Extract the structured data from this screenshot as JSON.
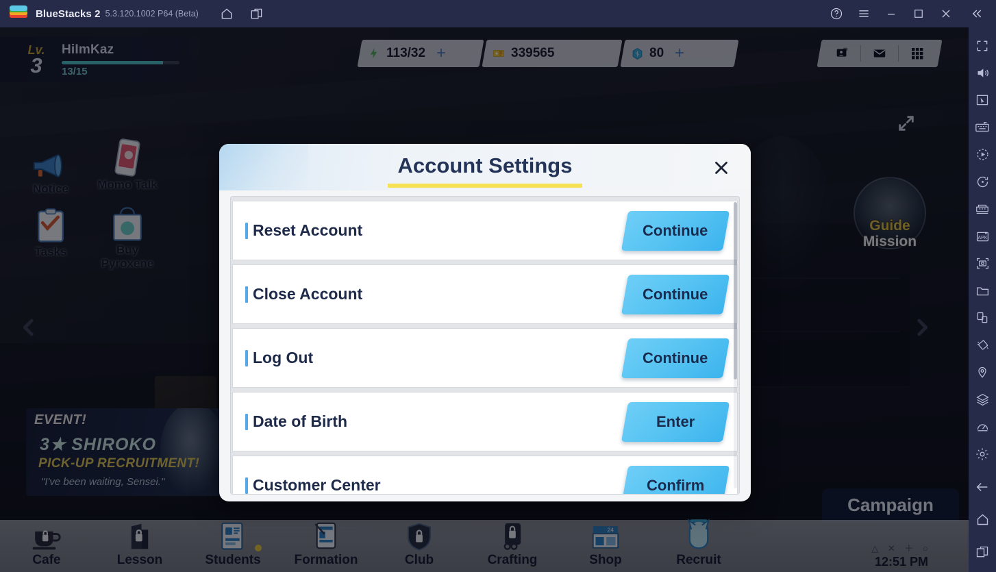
{
  "titlebar": {
    "app_name": "BlueStacks 2",
    "version": "5.3.120.1002 P64 (Beta)",
    "icons": {
      "logo": "bluestacks-logo",
      "home": "home-icon",
      "multi_instance": "multi-instance-icon",
      "help": "help-icon",
      "menu": "hamburger-menu-icon",
      "minimize": "minimize-icon",
      "maximize": "maximize-icon",
      "close": "close-icon",
      "collapse": "double-chevron-left-icon"
    }
  },
  "sidebar": {
    "items": [
      {
        "name": "fullscreen-icon"
      },
      {
        "name": "volume-icon"
      },
      {
        "name": "cursor-pointer-icon"
      },
      {
        "name": "keyboard-controls-icon"
      },
      {
        "name": "macro-record-icon"
      },
      {
        "name": "rotate-icon"
      },
      {
        "name": "multi-instance-manager-icon"
      },
      {
        "name": "install-apk-icon"
      },
      {
        "name": "screenshot-icon"
      },
      {
        "name": "media-folder-icon"
      },
      {
        "name": "copy-paste-icon"
      },
      {
        "name": "shake-icon"
      },
      {
        "name": "location-icon"
      },
      {
        "name": "layers-icon"
      },
      {
        "name": "performance-icon"
      },
      {
        "name": "settings-gear-icon"
      },
      {
        "name": "back-icon"
      },
      {
        "name": "home-icon"
      },
      {
        "name": "recents-icon"
      }
    ]
  },
  "game": {
    "player": {
      "lv_label": "Lv.",
      "level": "3",
      "name": "HiImKaz",
      "xp": "13/15"
    },
    "currencies": [
      {
        "icon": "ap-energy-icon",
        "value": "113/32",
        "plus": "+"
      },
      {
        "icon": "credits-icon",
        "value": "339565",
        "plus": ""
      },
      {
        "icon": "pyroxene-gem-icon",
        "value": "80",
        "plus": "+"
      }
    ],
    "hud_icons": [
      {
        "name": "profile-card-icon"
      },
      {
        "name": "mail-icon"
      },
      {
        "name": "grid-menu-icon"
      }
    ],
    "left_menu": [
      {
        "name": "notice",
        "label": "Notice",
        "icon": "megaphone-icon"
      },
      {
        "name": "momo-talk",
        "label": "Momo Talk",
        "icon": "phone-icon"
      },
      {
        "name": "tasks",
        "label": "Tasks",
        "icon": "clipboard-icon"
      },
      {
        "name": "buy-pyroxene",
        "label": "Buy Pyroxene",
        "icon": "shopping-bag-icon"
      }
    ],
    "event_banner": {
      "tag": "EVENT!",
      "line1": "3★ SHIROKO",
      "line2": "PICK-UP RECRUITMENT!",
      "line3": "\"I've been waiting, Sensei.\""
    },
    "guide_mission": {
      "line1": "Guide",
      "line2": "Mission"
    },
    "bottom_nav": [
      {
        "label": "Cafe",
        "icon": "cafe-cup-icon",
        "locked": true,
        "badge": false
      },
      {
        "label": "Lesson",
        "icon": "lesson-icon",
        "locked": true,
        "badge": false
      },
      {
        "label": "Students",
        "icon": "students-card-icon",
        "locked": false,
        "badge": true
      },
      {
        "label": "Formation",
        "icon": "formation-tablet-icon",
        "locked": false,
        "badge": false
      },
      {
        "label": "Club",
        "icon": "club-shield-icon",
        "locked": true,
        "badge": false
      },
      {
        "label": "Crafting",
        "icon": "crafting-icon",
        "locked": true,
        "badge": false
      },
      {
        "label": "Shop",
        "icon": "shop-store-icon",
        "locked": false,
        "badge": false
      },
      {
        "label": "Recruit",
        "icon": "recruit-icon",
        "locked": false,
        "badge": false
      }
    ],
    "campaign_tab": "Campaign",
    "clock": {
      "symbols": "△ ✕ ＋ ○",
      "time": "12:51 PM"
    }
  },
  "modal": {
    "title": "Account Settings",
    "close_icon": "close-icon",
    "rows": [
      {
        "label": "Reset Account",
        "button": "Continue"
      },
      {
        "label": "Close Account",
        "button": "Continue"
      },
      {
        "label": "Log Out",
        "button": "Continue"
      },
      {
        "label": "Date of Birth",
        "button": "Enter"
      },
      {
        "label": "Customer Center",
        "button": "Confirm"
      }
    ]
  },
  "colors": {
    "titlebar_bg": "#262b4a",
    "button_blue": "#58c4f2",
    "title_navy": "#243358",
    "accent_yellow": "#f5e152",
    "row_tick_blue": "#55a9e8"
  }
}
